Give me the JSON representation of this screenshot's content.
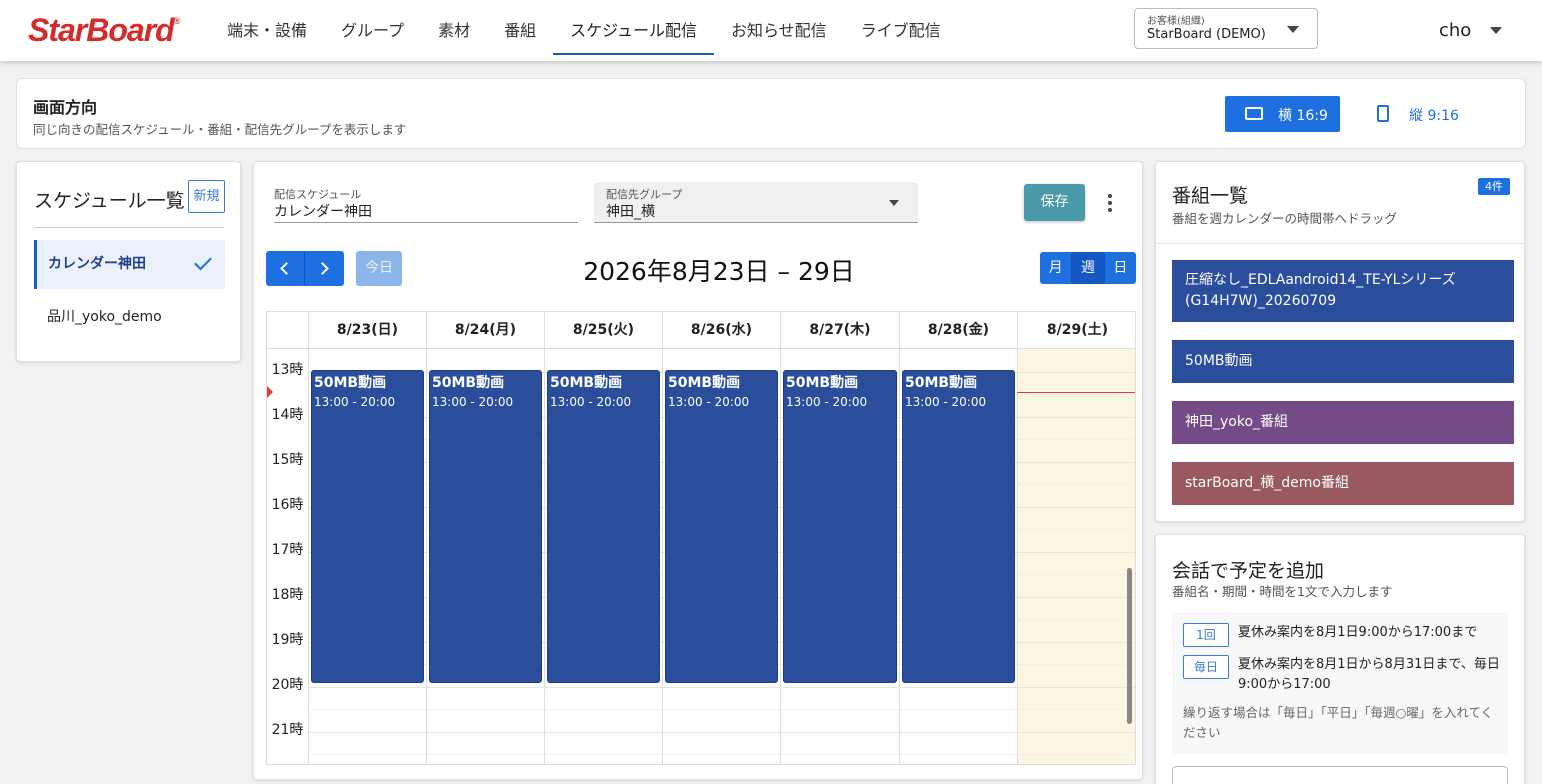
{
  "header": {
    "logo": "StarBoard",
    "nav": [
      "端末・設備",
      "グループ",
      "素材",
      "番組",
      "スケジュール配信",
      "お知らせ配信",
      "ライブ配信"
    ],
    "active_nav": "スケジュール配信",
    "tenant_label": "お客様(組織)",
    "tenant_value": "StarBoard (DEMO)",
    "user": "cho"
  },
  "orientation": {
    "title": "画面方向",
    "subtitle": "同じ向きの配信スケジュール・番組・配信先グループを表示します",
    "landscape_label": "横 16:9",
    "portrait_label": "縦 9:16",
    "selected": "landscape"
  },
  "schedule_list": {
    "title": "スケジュール一覧",
    "new_label": "新規",
    "items": [
      "カレンダー神田",
      "品川_yoko_demo"
    ],
    "selected": "カレンダー神田"
  },
  "editor": {
    "schedule_label": "配信スケジュール",
    "schedule_value": "カレンダー神田",
    "group_label": "配信先グループ",
    "group_value": "神田_横",
    "save_label": "保存"
  },
  "calendar": {
    "today_label": "今日",
    "title": "2026年8月23日 – 29日",
    "views": [
      "月",
      "週",
      "日"
    ],
    "active_view": "週",
    "days": [
      "8/23(日)",
      "8/24(月)",
      "8/25(火)",
      "8/26(水)",
      "8/27(木)",
      "8/28(金)",
      "8/29(土)"
    ],
    "hours": [
      "13時",
      "14時",
      "15時",
      "16時",
      "17時",
      "18時",
      "19時",
      "20時",
      "21時"
    ],
    "events": [
      {
        "title": "50MB動画",
        "time": "13:00 - 20:00"
      },
      {
        "title": "50MB動画",
        "time": "13:00 - 20:00"
      },
      {
        "title": "50MB動画",
        "time": "13:00 - 20:00"
      },
      {
        "title": "50MB動画",
        "time": "13:00 - 20:00"
      },
      {
        "title": "50MB動画",
        "time": "13:00 - 20:00"
      },
      {
        "title": "50MB動画",
        "time": "13:00 - 20:00"
      }
    ]
  },
  "programs": {
    "title": "番組一覧",
    "subtitle": "番組を週カレンダーの時間帯へドラッグ",
    "count": "4件",
    "items": [
      {
        "label": "圧縮なし_EDLAandroid14_TE-YLシリーズ(G14H7W)_20260709",
        "color": "#2b4e9c"
      },
      {
        "label": "50MB動画",
        "color": "#2b4e9c"
      },
      {
        "label": "神田_yoko_番組",
        "color": "#744a87"
      },
      {
        "label": "starBoard_横_demo番組",
        "color": "#9a5861"
      }
    ]
  },
  "chat": {
    "title": "会話で予定を追加",
    "subtitle": "番組名・期間・時間を1文で入力します",
    "examples": [
      {
        "badge": "1回",
        "text": "夏休み案内を8月1日9:00から17:00まで"
      },
      {
        "badge": "毎日",
        "text": "夏休み案内を8月1日から8月31日まで、毎日9:00から17:00"
      }
    ],
    "note": "繰り返す場合は「毎日」「平日」「毎週○曜」を入れてください"
  }
}
